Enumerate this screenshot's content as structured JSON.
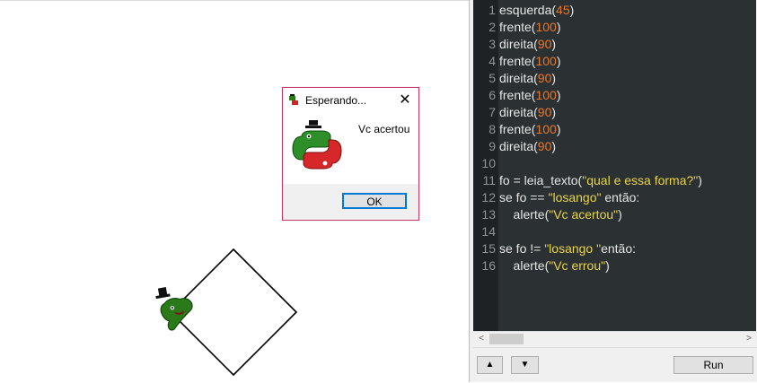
{
  "dialog": {
    "title": "Esperando...",
    "close": "✕",
    "message": "Vc acertou",
    "ok_label": "OK"
  },
  "editor": {
    "lines": [
      {
        "n": "1",
        "parts": [
          [
            "t",
            "esquerda("
          ],
          [
            "n",
            "45"
          ],
          [
            "t",
            ")"
          ]
        ]
      },
      {
        "n": "2",
        "parts": [
          [
            "t",
            "frente("
          ],
          [
            "n",
            "100"
          ],
          [
            "t",
            ")"
          ]
        ]
      },
      {
        "n": "3",
        "parts": [
          [
            "t",
            "direita("
          ],
          [
            "n",
            "90"
          ],
          [
            "t",
            ")"
          ]
        ]
      },
      {
        "n": "4",
        "parts": [
          [
            "t",
            "frente("
          ],
          [
            "n",
            "100"
          ],
          [
            "t",
            ")"
          ]
        ]
      },
      {
        "n": "5",
        "parts": [
          [
            "t",
            "direita("
          ],
          [
            "n",
            "90"
          ],
          [
            "t",
            ")"
          ]
        ]
      },
      {
        "n": "6",
        "parts": [
          [
            "t",
            "frente("
          ],
          [
            "n",
            "100"
          ],
          [
            "t",
            ")"
          ]
        ]
      },
      {
        "n": "7",
        "parts": [
          [
            "t",
            "direita("
          ],
          [
            "n",
            "90"
          ],
          [
            "t",
            ")"
          ]
        ]
      },
      {
        "n": "8",
        "parts": [
          [
            "t",
            "frente("
          ],
          [
            "n",
            "100"
          ],
          [
            "t",
            ")"
          ]
        ]
      },
      {
        "n": "9",
        "parts": [
          [
            "t",
            "direita("
          ],
          [
            "n",
            "90"
          ],
          [
            "t",
            ")"
          ]
        ]
      },
      {
        "n": "10",
        "parts": []
      },
      {
        "n": "11",
        "parts": [
          [
            "t",
            "fo = leia_texto("
          ],
          [
            "s",
            "\"qual e essa forma?\""
          ],
          [
            "t",
            ")"
          ]
        ]
      },
      {
        "n": "12",
        "parts": [
          [
            "t",
            "se fo == "
          ],
          [
            "s",
            "\"losango\""
          ],
          [
            "t",
            " então:"
          ]
        ]
      },
      {
        "n": "13",
        "parts": [
          [
            "t",
            "    alerte("
          ],
          [
            "s",
            "\"Vc acertou\""
          ],
          [
            "t",
            ")"
          ]
        ]
      },
      {
        "n": "14",
        "parts": []
      },
      {
        "n": "15",
        "parts": [
          [
            "t",
            "se fo != "
          ],
          [
            "s",
            "\"losango \""
          ],
          [
            "t",
            "então:"
          ]
        ]
      },
      {
        "n": "16",
        "parts": [
          [
            "t",
            "    alerte("
          ],
          [
            "s",
            "\"Vc errou\""
          ],
          [
            "t",
            ")"
          ]
        ]
      }
    ]
  },
  "controls": {
    "up_label": "▲",
    "down_label": "▼",
    "run_label": "Run",
    "scroll_left": "<",
    "scroll_right": ">"
  },
  "colors": {
    "number": "#e8772a",
    "string": "#e8d44a",
    "code_bg": "#2b3033",
    "gutter_bg": "#1e2224",
    "dialog_border": "#c8356b"
  },
  "icons": {
    "turtle": "python-turtle-icon",
    "dialog_app": "python-logo-icon"
  }
}
